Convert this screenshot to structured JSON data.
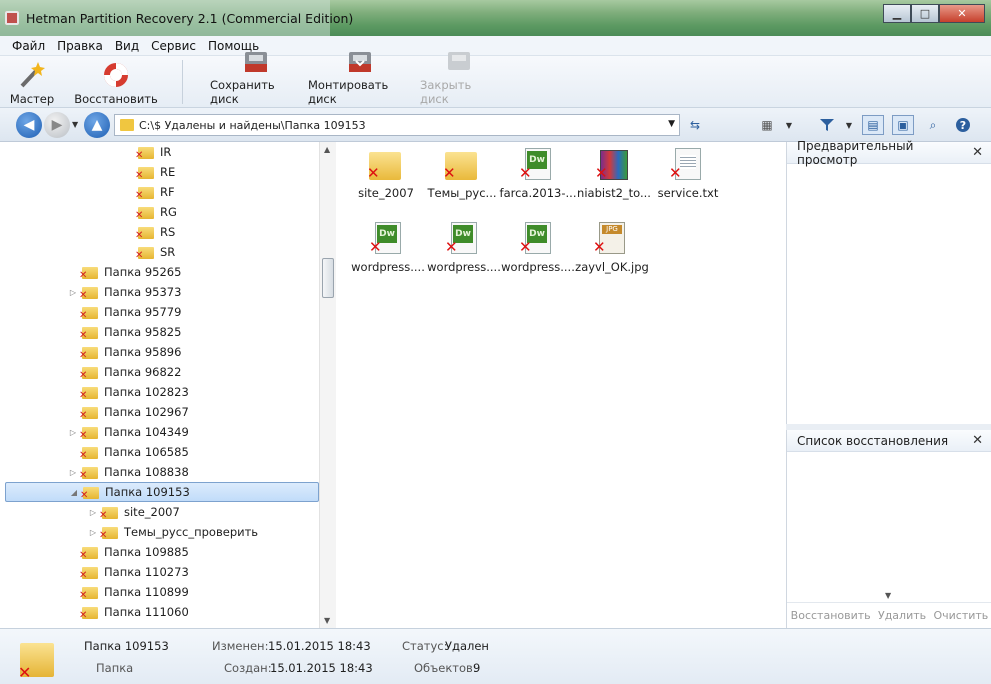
{
  "window": {
    "title": "Hetman Partition Recovery 2.1 (Commercial Edition)",
    "minimize": "▁",
    "maximize": "□",
    "close": "✕"
  },
  "menu": [
    "Файл",
    "Правка",
    "Вид",
    "Сервис",
    "Помощь"
  ],
  "toolbar": {
    "wizard_label": "Мастер",
    "restore_label": "Восстановить",
    "save_disk_label": "Сохранить диск",
    "mount_disk_label": "Монтировать диск",
    "close_disk_label": "Закрыть диск"
  },
  "address": {
    "path": "C:\\$ Удалены и найдены\\Папка 109153"
  },
  "tree": {
    "items": [
      {
        "label": "IR",
        "level": 3,
        "expander": ""
      },
      {
        "label": "RE",
        "level": 3,
        "expander": ""
      },
      {
        "label": "RF",
        "level": 3,
        "expander": ""
      },
      {
        "label": "RG",
        "level": 3,
        "expander": ""
      },
      {
        "label": "RS",
        "level": 3,
        "expander": ""
      },
      {
        "label": "SR",
        "level": 3,
        "expander": ""
      },
      {
        "label": "Папка 95265",
        "level": 1,
        "expander": ""
      },
      {
        "label": "Папка 95373",
        "level": 1,
        "expander": "▷"
      },
      {
        "label": "Папка 95779",
        "level": 1,
        "expander": ""
      },
      {
        "label": "Папка 95825",
        "level": 1,
        "expander": ""
      },
      {
        "label": "Папка 95896",
        "level": 1,
        "expander": ""
      },
      {
        "label": "Папка 96822",
        "level": 1,
        "expander": ""
      },
      {
        "label": "Папка 102823",
        "level": 1,
        "expander": ""
      },
      {
        "label": "Папка 102967",
        "level": 1,
        "expander": ""
      },
      {
        "label": "Папка 104349",
        "level": 1,
        "expander": "▷"
      },
      {
        "label": "Папка 106585",
        "level": 1,
        "expander": ""
      },
      {
        "label": "Папка 108838",
        "level": 1,
        "expander": "▷"
      },
      {
        "label": "Папка 109153",
        "level": 1,
        "expander": "◢",
        "selected": true
      },
      {
        "label": "site_2007",
        "level": 2,
        "expander": "▷"
      },
      {
        "label": "Темы_русс_проверить",
        "level": 2,
        "expander": "▷"
      },
      {
        "label": "Папка 109885",
        "level": 1,
        "expander": ""
      },
      {
        "label": "Папка 110273",
        "level": 1,
        "expander": ""
      },
      {
        "label": "Папка 110899",
        "level": 1,
        "expander": ""
      },
      {
        "label": "Папка 111060",
        "level": 1,
        "expander": ""
      }
    ]
  },
  "files": [
    {
      "label": "site_2007",
      "kind": "folder"
    },
    {
      "label": "Темы_рус...",
      "kind": "folder"
    },
    {
      "label": "farca.2013-...",
      "kind": "dw"
    },
    {
      "label": "niabist2_to...",
      "kind": "rar"
    },
    {
      "label": "service.txt",
      "kind": "txt"
    },
    {
      "label": "wordpress....",
      "kind": "dw"
    },
    {
      "label": "wordpress....",
      "kind": "dw"
    },
    {
      "label": "wordpress....",
      "kind": "dw"
    },
    {
      "label": "zayvl_OK.jpg",
      "kind": "jpg"
    }
  ],
  "preview_panel": {
    "title": "Предварительный просмотр",
    "close": "✕"
  },
  "recovery_panel": {
    "title": "Список восстановления",
    "close": "✕",
    "restore_label": "Восстановить",
    "delete_label": "Удалить",
    "clear_label": "Очистить"
  },
  "status": {
    "name": "Папка 109153",
    "type": "Папка",
    "modified_label": "Изменен:",
    "modified": "15.01.2015 18:43",
    "created_label": "Создан:",
    "created": "15.01.2015 18:43",
    "status_label": "Статус:",
    "status": "Удален",
    "objects_label": "Объектов:",
    "objects": "9"
  },
  "colors": {
    "accent": "#2c5f9e",
    "deleted": "#d11111",
    "folder": "#e9b93b"
  }
}
